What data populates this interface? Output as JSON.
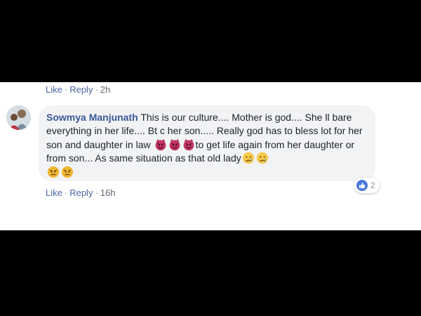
{
  "top_actions": {
    "like": "Like",
    "reply": "Reply",
    "time": "2h"
  },
  "comment": {
    "author": "Sowmya Manjunath",
    "text_1": "This is our culture.... Mother is god.... She ll bare everything in her life.... Bt c her son..... Really god has to bless lot for her son and daughter in law",
    "text_2": "to get life again from her daughter or from son... As same situation as that old lady",
    "emojis_1": [
      "devil-face",
      "devil-face",
      "devil-face"
    ],
    "emojis_2": [
      "sad-tear-face",
      "sad-tear-face"
    ],
    "emojis_3": [
      "angry-face",
      "angry-face"
    ]
  },
  "reactions": {
    "type": "like",
    "count": "2"
  },
  "bottom_actions": {
    "like": "Like",
    "reply": "Reply",
    "time": "16h"
  },
  "colors": {
    "link": "#4b67a1",
    "author": "#385898",
    "bubble": "#f2f3f5",
    "like_badge": "#4a77d9"
  }
}
